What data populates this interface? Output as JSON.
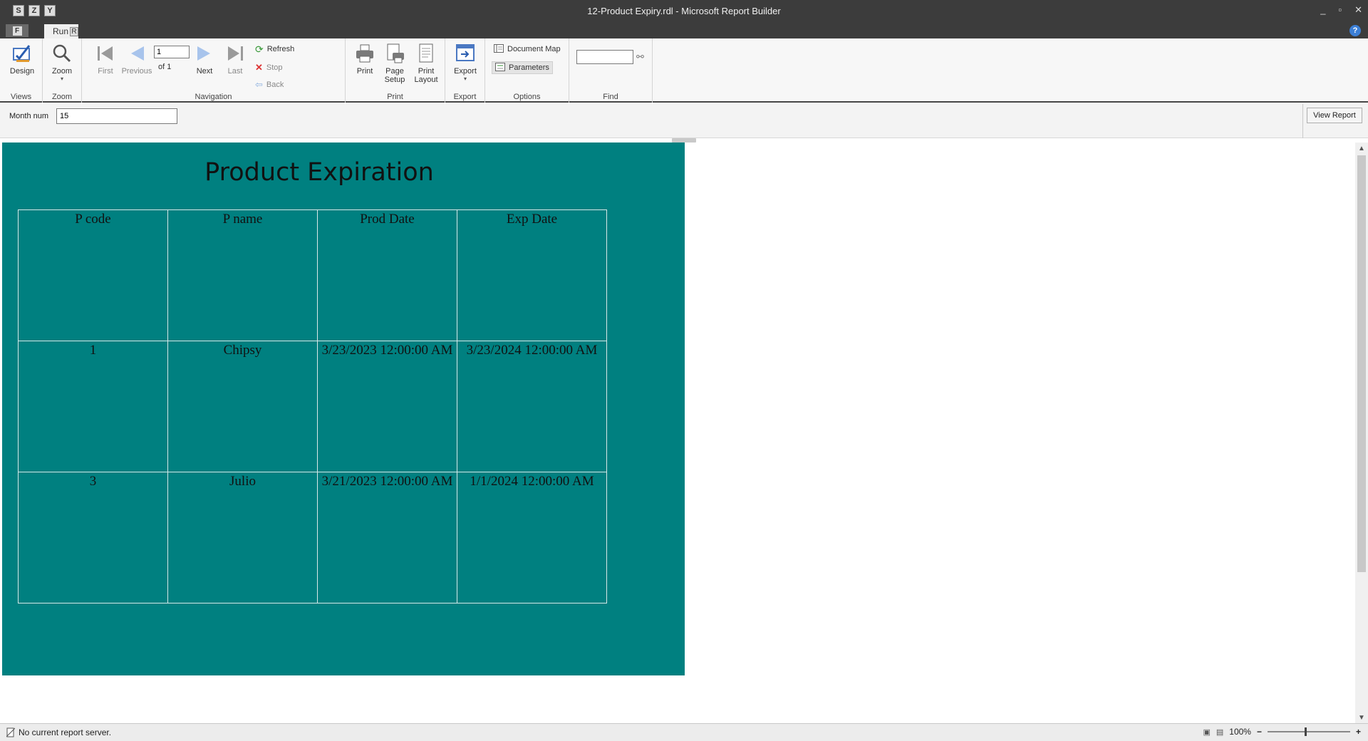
{
  "window": {
    "title": "12-Product Expiry.rdl - Microsoft Report Builder",
    "qat": [
      "S",
      "Z",
      "Y"
    ],
    "controls": [
      "_",
      "▫",
      "✕"
    ]
  },
  "tabs": {
    "file_key": "F",
    "run_label": "Run",
    "run_key": "R",
    "help": "?"
  },
  "ribbon": {
    "views": {
      "label": "Views",
      "design": "Design"
    },
    "zoom": {
      "label": "Zoom",
      "zoom": "Zoom"
    },
    "navigation": {
      "label": "Navigation",
      "first": "First",
      "previous": "Previous",
      "page_value": "1",
      "of_text": "of  1",
      "next": "Next",
      "last": "Last",
      "refresh": "Refresh",
      "stop": "Stop",
      "back": "Back"
    },
    "print": {
      "label": "Print",
      "print": "Print",
      "page_setup_1": "Page",
      "page_setup_2": "Setup",
      "print_layout_1": "Print",
      "print_layout_2": "Layout"
    },
    "export": {
      "label": "Export",
      "export": "Export"
    },
    "options": {
      "label": "Options",
      "document_map": "Document Map",
      "parameters": "Parameters"
    },
    "find": {
      "label": "Find",
      "value": ""
    }
  },
  "parameters": {
    "month_label": "Month num",
    "month_value": "15",
    "view_report": "View Report"
  },
  "report": {
    "title": "Product Expiration",
    "headers": [
      "P code",
      "P name",
      "Prod Date",
      "Exp Date"
    ],
    "rows": [
      [
        "1",
        "Chipsy",
        "3/23/2023 12:00:00 AM",
        "3/23/2024 12:00:00 AM"
      ],
      [
        "3",
        "Julio",
        "3/21/2023 12:00:00 AM",
        "1/1/2024 12:00:00 AM"
      ]
    ],
    "background_color": "#008080"
  },
  "status": {
    "text": "No current report server.",
    "zoom": "100%",
    "zoom_out": "−",
    "zoom_in": "+"
  }
}
